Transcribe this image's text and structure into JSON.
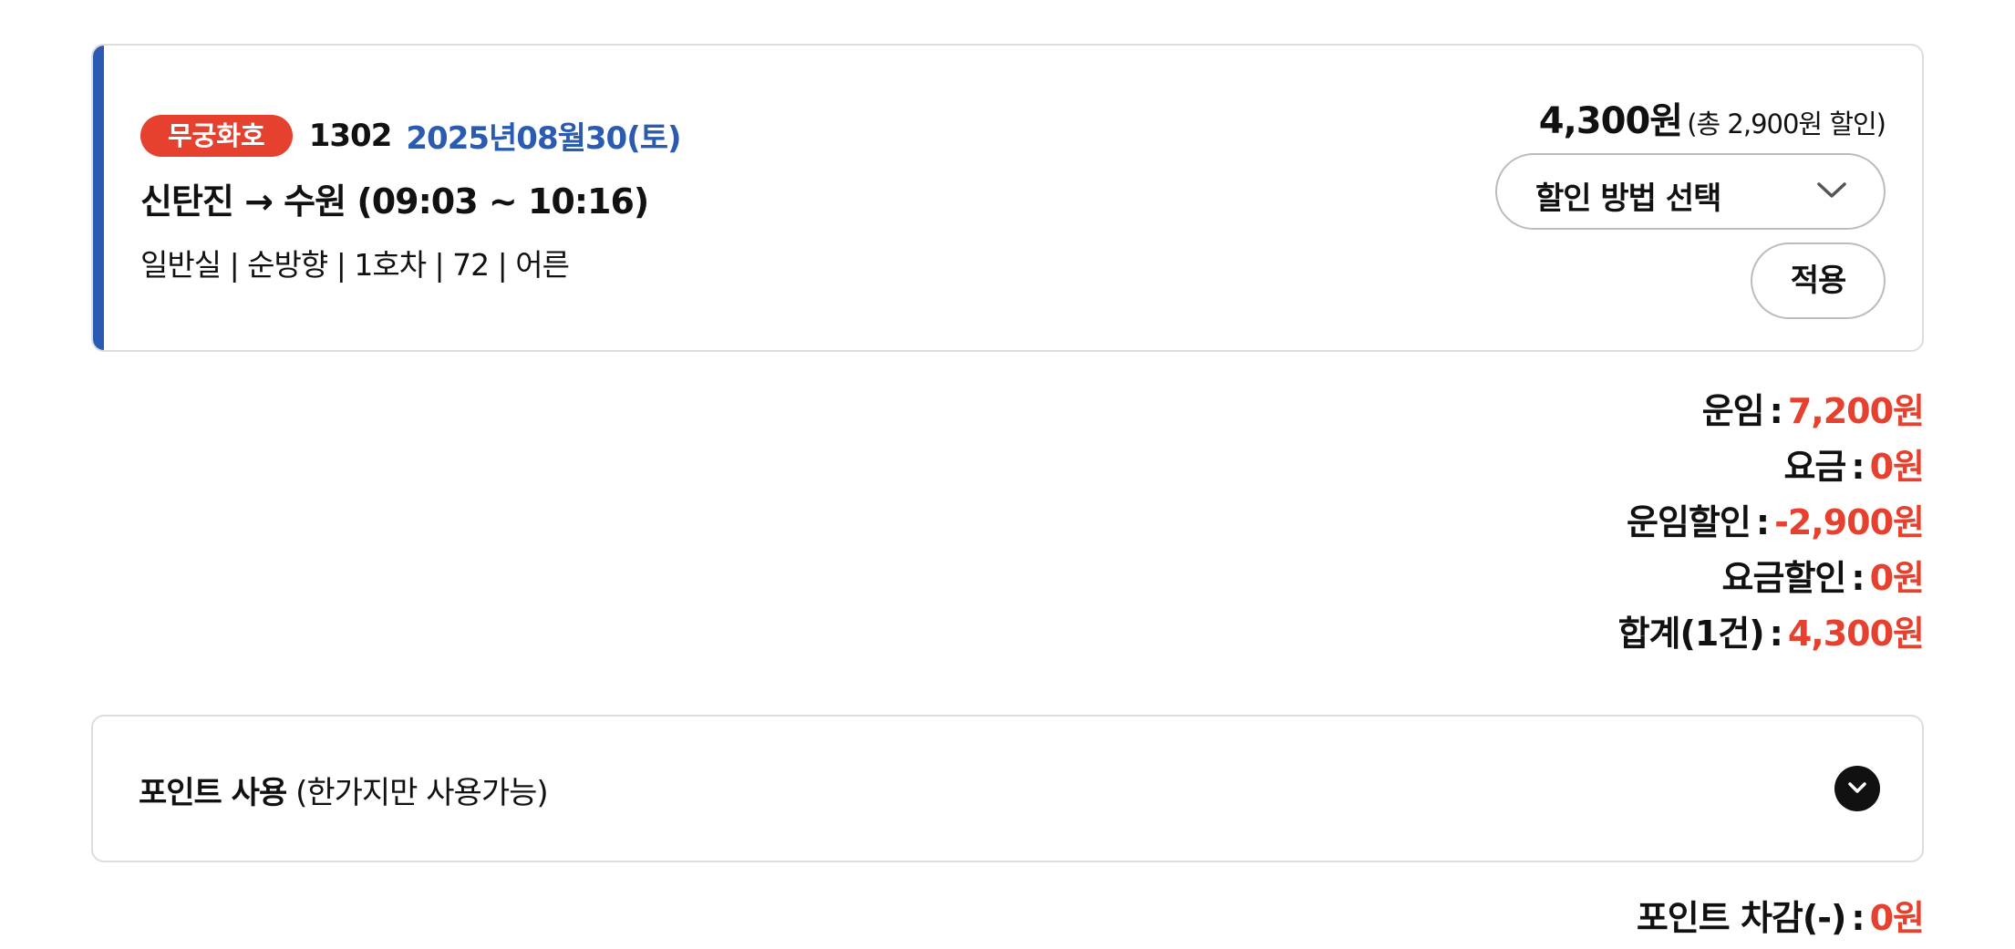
{
  "ticket": {
    "train_type": "무궁화호",
    "train_number": "1302",
    "date": "2025년08월30(토)",
    "route": "신탄진 → 수원 (09:03 ~ 10:16)",
    "seat_info": "일반실 | 순방향 | 1호차 | 72 | 어른",
    "price": "4,300원",
    "discount_note": "(총 2,900원 할인)",
    "discount_select_label": "할인 방법 선택",
    "apply_label": "적용",
    "accent_color": "#2a5bb0",
    "badge_color": "#e5412e"
  },
  "summary": [
    {
      "label": "운임",
      "value": "7,200원"
    },
    {
      "label": "요금",
      "value": "0원"
    },
    {
      "label": "운임할인",
      "value": "-2,900원"
    },
    {
      "label": "요금할인",
      "value": "0원"
    },
    {
      "label": "합계(1건)",
      "value": "4,300원"
    }
  ],
  "summary_separator": ":",
  "points": {
    "title": "포인트 사용",
    "note": "(한가지만 사용가능)",
    "expand_icon": "chevron-down-circle-icon",
    "deduct_label": "포인트 차감(-)",
    "deduct_value": "0원"
  }
}
